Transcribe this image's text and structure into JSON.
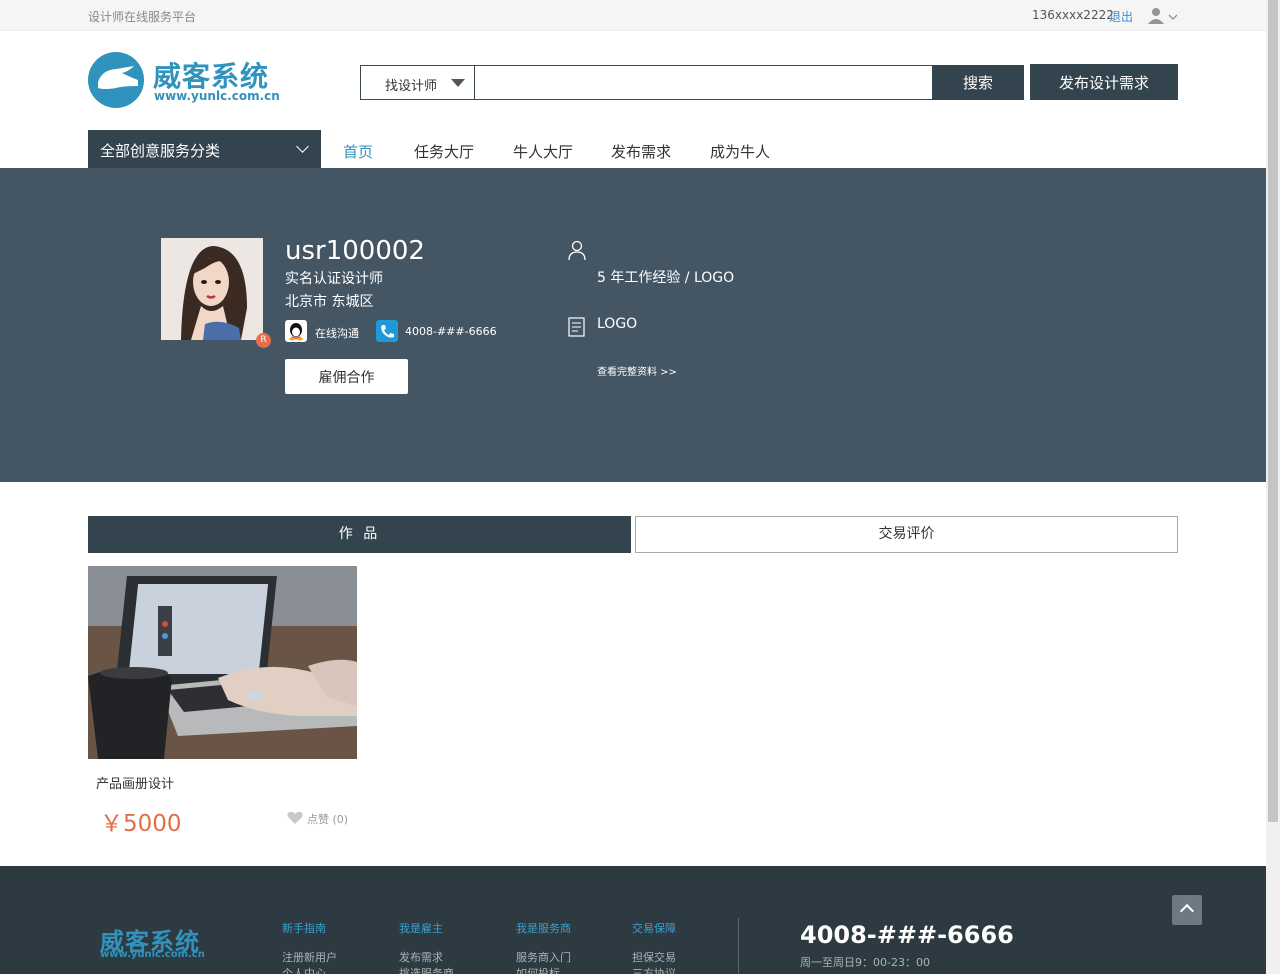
{
  "topbar": {
    "slogan": "设计师在线服务平台",
    "phone": "136xxxx2222",
    "logout": "退出"
  },
  "header": {
    "brand": "威客系统",
    "domain": "www.yunlc.com.cn",
    "search_type": "找设计师",
    "search_value": "",
    "search_button": "搜索",
    "publish_button": "发布设计需求"
  },
  "nav": {
    "category_menu": "全部创意服务分类",
    "items": [
      "首页",
      "任务大厅",
      "牛人大厅",
      "发布需求",
      "成为牛人"
    ],
    "active_index": 0
  },
  "profile": {
    "username": "usr100002",
    "title": "实名认证设计师",
    "city": "北京市 东城区",
    "badge": "R",
    "chat_label": "在线沟通",
    "tel": "4008-###-6666",
    "hire_button": "雇佣合作",
    "experience": "5 年工作经验 / LOGO",
    "skill": "LOGO",
    "full_profile_link": "查看完整资料 >>"
  },
  "tabs": {
    "works": "作 品",
    "reviews": "交易评价",
    "active": "works"
  },
  "works": [
    {
      "title": "产品画册设计",
      "price": "￥5000",
      "likes": "点赞 (0)"
    }
  ],
  "footer": {
    "brand": "威客系统",
    "domain": "www.yunlc.com.cn",
    "columns": [
      {
        "head": "新手指南",
        "links": [
          "注册新用户",
          "个人中心"
        ]
      },
      {
        "head": "我是雇主",
        "links": [
          "发布需求",
          "挑选服务商"
        ]
      },
      {
        "head": "我是服务商",
        "links": [
          "服务商入门",
          "如何投标"
        ]
      },
      {
        "head": "交易保障",
        "links": [
          "担保交易",
          "三方协议"
        ]
      }
    ],
    "phone": "4008-###-6666",
    "hours": "周一至周日9：00-23：00"
  },
  "colors": {
    "accent": "#2f93bd",
    "dark": "#34444e",
    "banner": "#445664",
    "price": "#e56e4a",
    "footer": "#2d3a42"
  }
}
